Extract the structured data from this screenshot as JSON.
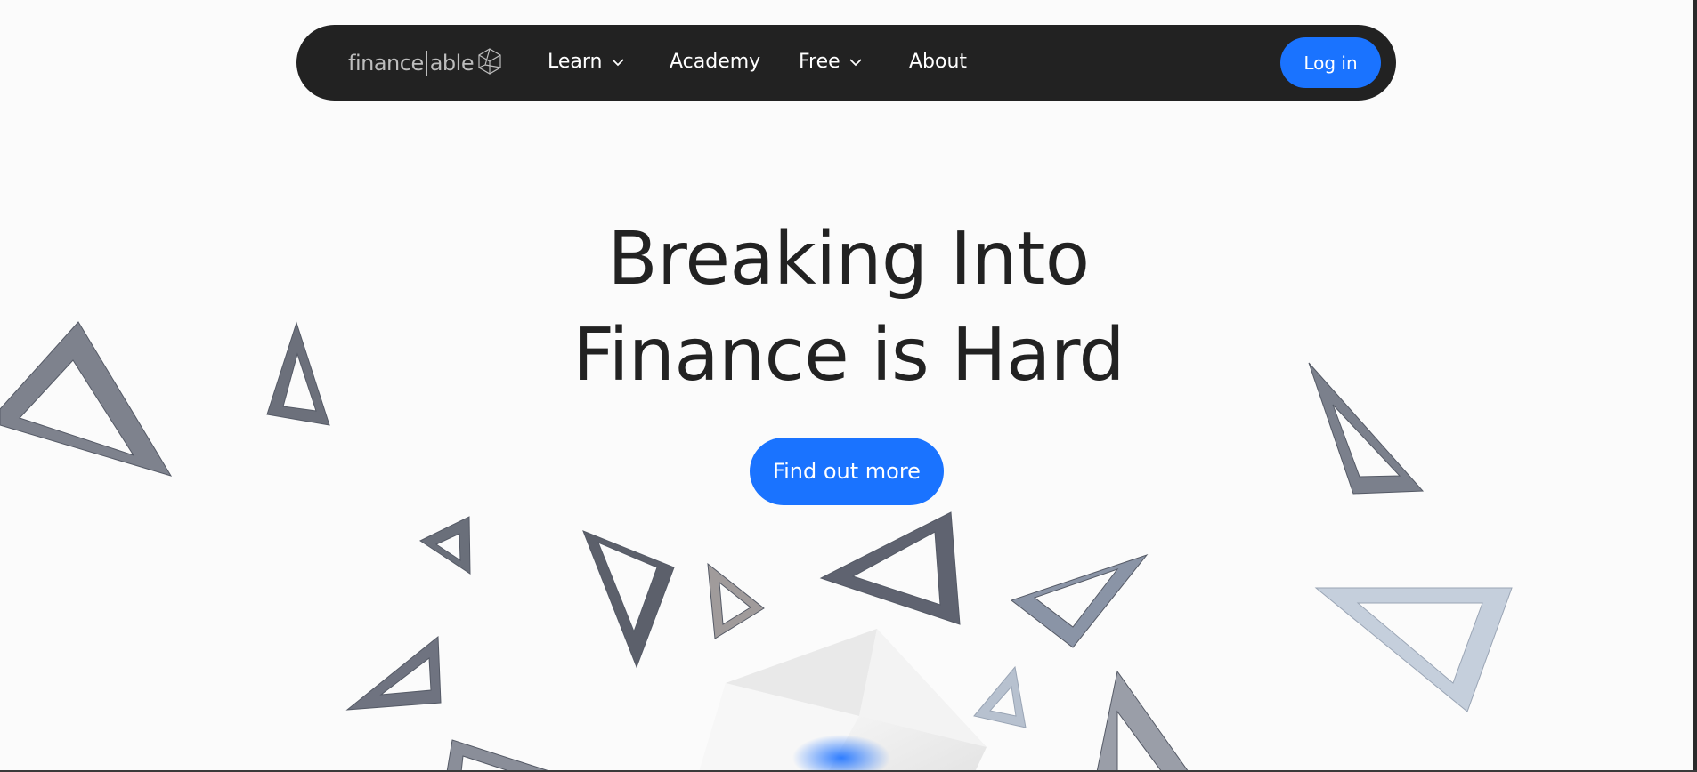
{
  "nav": {
    "logo_left": "finance",
    "logo_right": "able",
    "items": [
      {
        "label": "Learn",
        "has_dropdown": true
      },
      {
        "label": "Academy",
        "has_dropdown": false
      },
      {
        "label": "Free",
        "has_dropdown": true
      },
      {
        "label": "About",
        "has_dropdown": false
      }
    ],
    "login_label": "Log in"
  },
  "hero": {
    "title_line1": "Breaking Into",
    "title_line2": "Finance is Hard",
    "cta_label": "Find out more"
  },
  "colors": {
    "accent": "#1a73ff",
    "nav_background": "#222222",
    "page_background": "#fbfbfb",
    "text": "#222222"
  },
  "icons": [
    "logo-polyhedron-icon",
    "chevron-down-icon"
  ]
}
